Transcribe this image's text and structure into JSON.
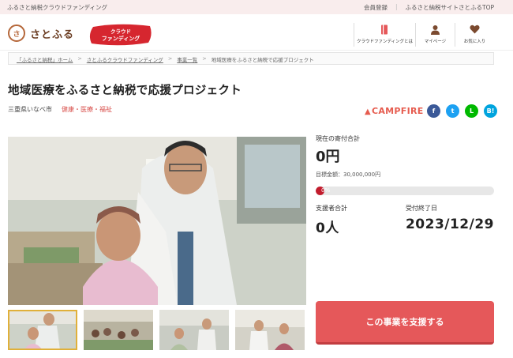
{
  "topbar": {
    "tagline": "ふるさと納税クラウドファンディング",
    "links": [
      "会員登録",
      "ふるさと納税サイトさとふるTOP"
    ]
  },
  "header": {
    "logo_text": "さとふる",
    "logo_mark": "さ",
    "badge_line1": "クラウド",
    "badge_line2": "ファンディング",
    "nav": [
      {
        "label": "クラウドファンディングとは",
        "icon": "book-icon"
      },
      {
        "label": "マイページ",
        "icon": "user-icon"
      },
      {
        "label": "お気に入り",
        "icon": "heart-icon"
      }
    ]
  },
  "breadcrumb": [
    "「ふるさと納税」ホーム",
    "さとふるクラウドファンディング",
    "事業一覧",
    "地域医療をふるさと納税で応援プロジェクト"
  ],
  "project": {
    "title": "地域医療をふるさと納税で応援プロジェクト",
    "location": "三重県いなべ市",
    "category": "健康・医療・福祉",
    "partner": "CAMPFIRE"
  },
  "social": [
    {
      "name": "facebook",
      "glyph": "f",
      "color": "#3b5998"
    },
    {
      "name": "twitter",
      "glyph": "t",
      "color": "#1da1f2"
    },
    {
      "name": "line",
      "glyph": "L",
      "color": "#00b900"
    },
    {
      "name": "hatena",
      "glyph": "B!",
      "color": "#00a4de"
    }
  ],
  "funding": {
    "current_label": "現在の寄付合計",
    "current_amount": "0円",
    "goal": "目標金額：30,000,000円",
    "progress_text": "0%",
    "progress": 0,
    "supporters_label": "支援者合計",
    "supporters": "0人",
    "deadline_label": "受付終了日",
    "deadline": "2023/12/29",
    "support_button": "この事業を支援する"
  },
  "colors": {
    "accent": "#e5585a",
    "progress": "#c21c2d",
    "category": "#d9534f",
    "campfire": "#e65c4f"
  }
}
